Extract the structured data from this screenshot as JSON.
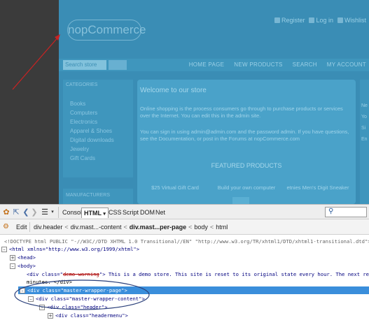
{
  "store": {
    "logo": "nopCommerce",
    "header_links": [
      "Register",
      "Log in",
      "Wishlist"
    ],
    "search_placeholder": "Search store",
    "menu": [
      "HOME PAGE",
      "NEW PRODUCTS",
      "SEARCH",
      "MY ACCOUNT"
    ],
    "sidebar_title": "CATEGORIES",
    "categories": [
      "Books",
      "Computers",
      "Electronics",
      "Apparel & Shoes",
      "Digital downloads",
      "Jewelry",
      "Gift Cards"
    ],
    "sidebar2_title": "MANUFACTURERS",
    "welcome_title": "Welcome to our store",
    "welcome_text1": "Online shopping is the process consumers go through to purchase products or services over the Internet. You can edit this in the admin site.",
    "welcome_text2": "If you have questions, see the Documentation, or post in the Forums at nopCommerce.com",
    "welcome_text2_full": "You can sign in using admin@admin.com and the password admin. If you have questions, see the Documentation, or post in the Forums at nopCommerce.com",
    "featured": "FEATURED PRODUCTS",
    "products": [
      "$25 Virtual Gift Card",
      "Build your own computer",
      "etnies Men's Digit Sneaker"
    ],
    "right_col": [
      "Ne",
      "Yo",
      "Si",
      "En"
    ]
  },
  "toolbar": {
    "tabs": [
      "Console",
      "HTML",
      "CSS",
      "Script",
      "DOM",
      "Net"
    ],
    "active_tab": "HTML",
    "search_icon": "magnifier-icon"
  },
  "breadcrumb": {
    "edit": "Edit",
    "items": [
      "div.header",
      "div.mast...-content",
      "div.mast...per-page",
      "body",
      "html"
    ],
    "current": "div.mast...per-page"
  },
  "tree": {
    "doctype": "<!DOCTYPE html PUBLIC \"-//W3C//DTD XHTML 1.0 Transitional//EN\" \"http://www.w3.org/TR/xhtml1/DTD/xhtml1-transitional.dtd\">",
    "html_open": "<html xmlns=\"http://www.w3.org/1999/xhtml\">",
    "head": "<head>",
    "body": "<body>",
    "demo_div_open": "<div class=\"",
    "demo_class": "demo-warning",
    "demo_div_text": "\"> This is a demo store. This site is reset to its original state every hour. The next reset will be",
    "demo_div_text2": "minutes. </div>",
    "wrapper_page": "<div class=\"master-wrapper-page\">",
    "wrapper_content": "<div class=\"master-wrapper-content\">",
    "header": "<div class=\"header\">",
    "headermenu": "<div class=\"headermenu\">"
  },
  "colors": {
    "highlight": "#3a8edb",
    "annotation": "#2a3f7a",
    "arrow": "#cc2222"
  }
}
